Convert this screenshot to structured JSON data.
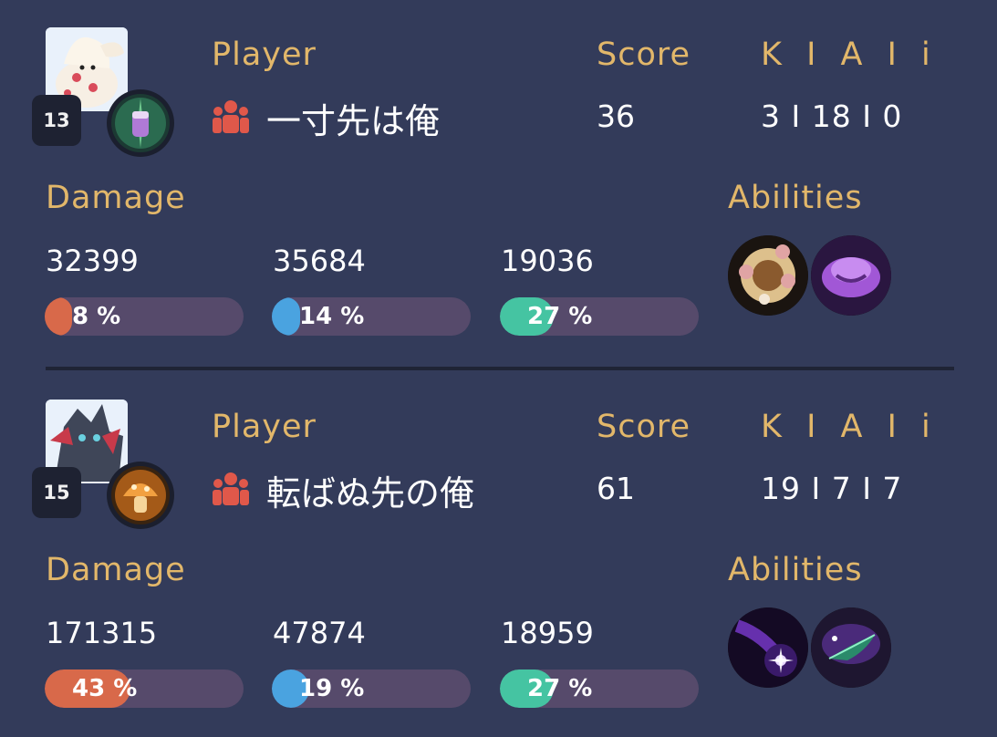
{
  "labels": {
    "player": "Player",
    "score": "Score",
    "kai": "K I A I i",
    "damage": "Damage",
    "abilities": "Abilities"
  },
  "colors": {
    "background": "#333b5a",
    "label_gold": "#e2b76a",
    "bar_track": "#564a6b",
    "damage_dealt": "#d8694a",
    "damage_taken": "#4aa3e0",
    "healing": "#45c4a2",
    "party_icon": "#e0584a"
  },
  "players": [
    {
      "level": "13",
      "name": "一寸先は俺",
      "score": "36",
      "kai": "3 I 18 I 0",
      "portrait_icon": "alcremie-portrait-icon",
      "held_item_icon": "held-item-jar-icon",
      "damage": [
        {
          "value": "32399",
          "percent_text": "8 %",
          "percent": 8,
          "color": "#d8694a"
        },
        {
          "value": "35684",
          "percent_text": "14 %",
          "percent": 14,
          "color": "#4aa3e0"
        },
        {
          "value": "19036",
          "percent_text": "27 %",
          "percent": 27,
          "color": "#45c4a2"
        }
      ],
      "abilities": [
        "cream-ring-ability-icon",
        "purple-cloud-ability-icon"
      ]
    },
    {
      "level": "15",
      "name": "転ばぬ先の俺",
      "score": "61",
      "kai": "19 I 7 I 7",
      "portrait_icon": "zoroark-portrait-icon",
      "held_item_icon": "held-item-mushroom-icon",
      "damage": [
        {
          "value": "171315",
          "percent_text": "43 %",
          "percent": 43,
          "color": "#d8694a"
        },
        {
          "value": "47874",
          "percent_text": "19 %",
          "percent": 19,
          "color": "#4aa3e0"
        },
        {
          "value": "18959",
          "percent_text": "27 %",
          "percent": 27,
          "color": "#45c4a2"
        }
      ],
      "abilities": [
        "shadow-orb-ability-icon",
        "dark-slash-ability-icon"
      ]
    }
  ]
}
